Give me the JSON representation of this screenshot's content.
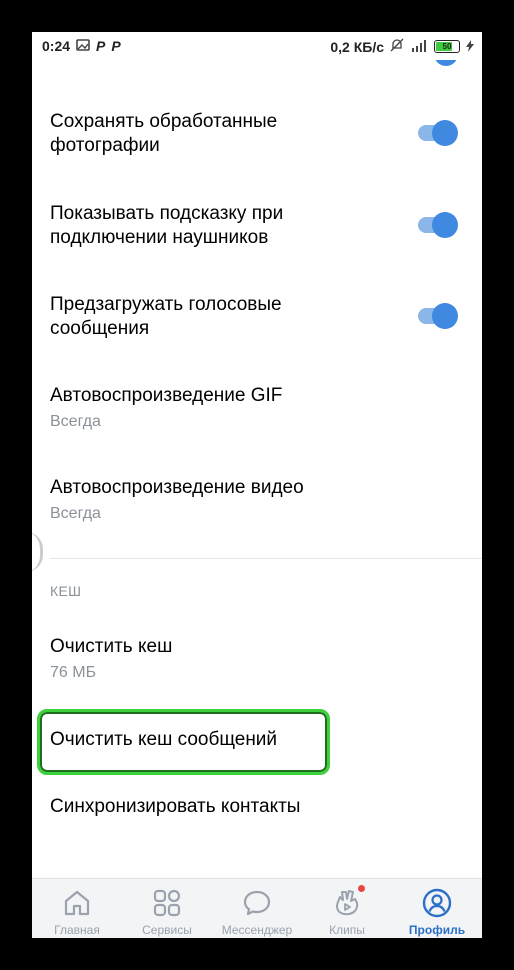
{
  "status_bar": {
    "time": "0:24",
    "network_speed": "0,2 КБ/с",
    "battery_level": "50"
  },
  "settings": {
    "rows": [
      {
        "title_line1": "Сохранять обработанные",
        "title_line2": "фотографии",
        "toggle": true
      },
      {
        "title_line1": "Показывать подсказку при",
        "title_line2": "подключении наушников",
        "toggle": true
      },
      {
        "title_line1": "Предзагружать голосовые",
        "title_line2": "сообщения",
        "toggle": true
      },
      {
        "title": "Автовоспроизведение GIF",
        "subtitle": "Всегда"
      },
      {
        "title": "Автовоспроизведение видео",
        "subtitle": "Всегда"
      }
    ],
    "cache_section": {
      "header": "КЕШ",
      "clear_cache": "Очистить кеш",
      "cache_size": "76 МБ",
      "clear_messages_cache": "Очистить кеш сообщений",
      "sync_contacts": "Синхронизировать контакты"
    }
  },
  "tabbar": {
    "tabs": [
      {
        "label": "Главная",
        "icon": "home-icon"
      },
      {
        "label": "Сервисы",
        "icon": "services-icon"
      },
      {
        "label": "Мессенджер",
        "icon": "messenger-icon"
      },
      {
        "label": "Клипы",
        "icon": "clips-icon"
      },
      {
        "label": "Профиль",
        "icon": "profile-icon",
        "active": true
      }
    ]
  },
  "colors": {
    "accent": "#3f8ae0",
    "highlight": "#3ed13e",
    "badge": "#e64646"
  }
}
